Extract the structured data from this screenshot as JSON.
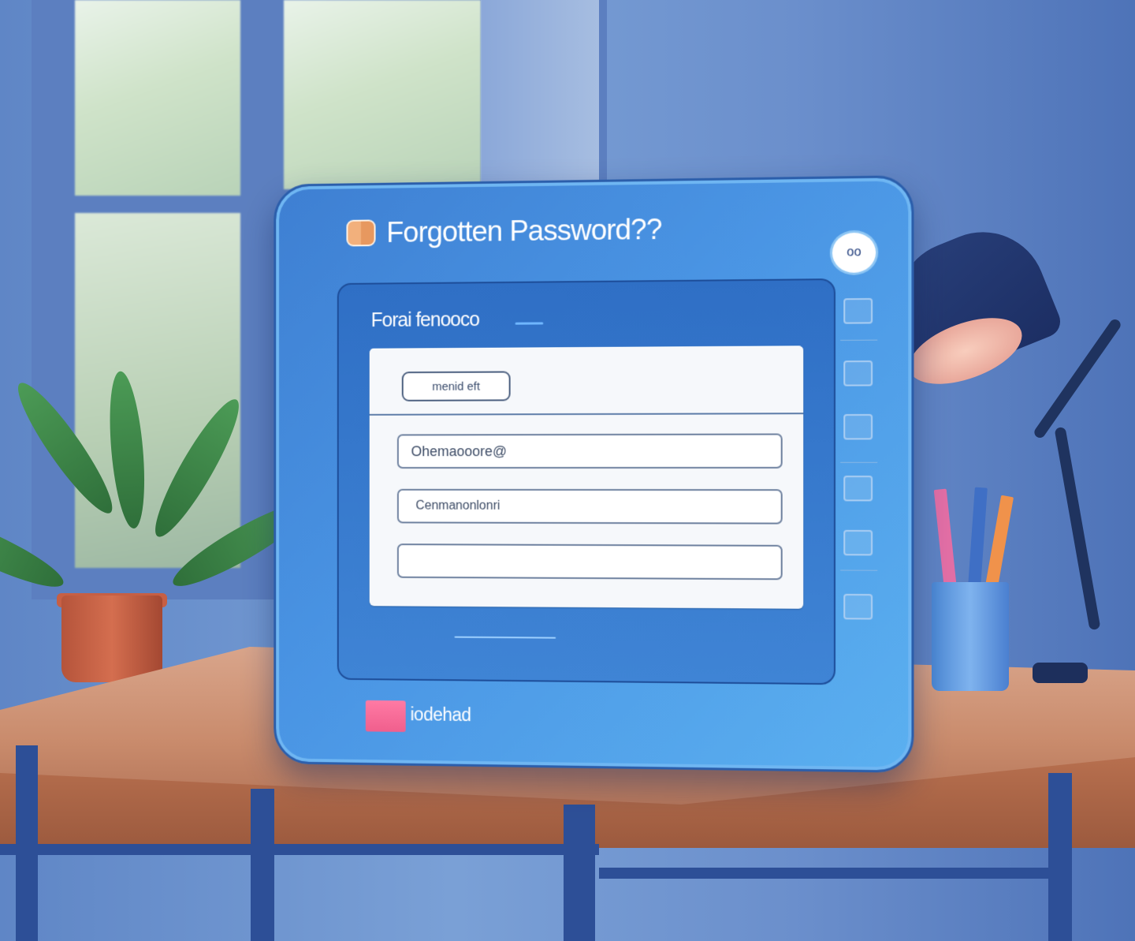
{
  "app": {
    "title": "Forgotten Password??",
    "menu_button_label": "oo"
  },
  "panel": {
    "heading": "Forai fenooco",
    "tab_label": "menid eft",
    "fields": [
      {
        "value": "Ohemaooore@"
      },
      {
        "value": "Cenmanonlonri"
      },
      {
        "value": ""
      }
    ]
  },
  "sidebar": {
    "icons": [
      "image-icon",
      "folder-icon",
      "window-icon",
      "card-icon",
      "keyboard-icon",
      "document-icon"
    ]
  },
  "footer": {
    "badge_label": "iodehad"
  },
  "colors": {
    "device_blue": "#4a95e4",
    "panel_blue": "#2f6fc5",
    "badge_pink": "#f05f8d",
    "logo_orange": "#f2b07c"
  }
}
